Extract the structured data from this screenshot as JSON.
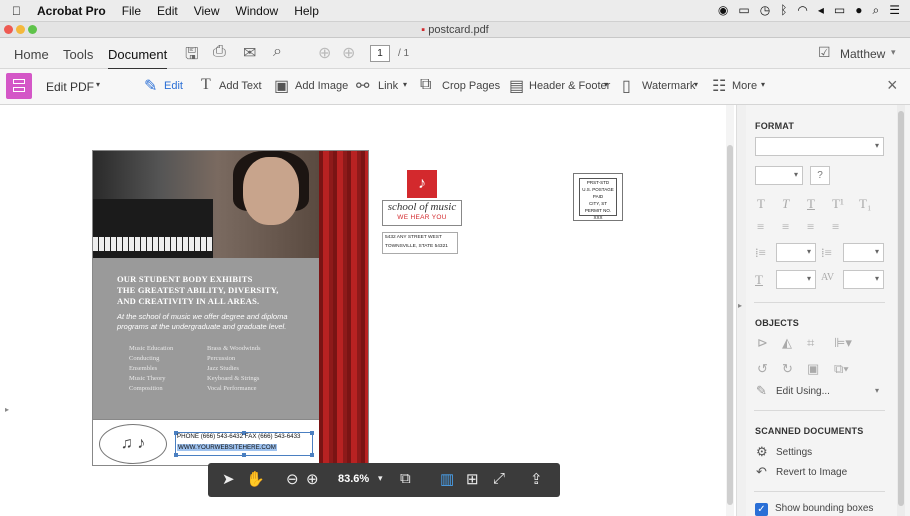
{
  "menubar": {
    "app": "Acrobat Pro",
    "items": [
      "File",
      "Edit",
      "View",
      "Window",
      "Help"
    ]
  },
  "window": {
    "title": "postcard.pdf"
  },
  "topnav": {
    "tabs": [
      "Home",
      "Tools",
      "Document"
    ],
    "page_current": "1",
    "page_total": "/ 1",
    "user": "Matthew"
  },
  "edit_toolbar": {
    "title": "Edit PDF",
    "tools": {
      "edit": "Edit",
      "add_text": "Add Text",
      "add_image": "Add Image",
      "link": "Link",
      "crop": "Crop Pages",
      "header_footer": "Header & Footer",
      "watermark": "Watermark",
      "more": "More"
    }
  },
  "flyer": {
    "headline": [
      "OUR STUDENT BODY EXHIBITS",
      "THE GREATEST ABILITY, DIVERSITY,",
      "AND CREATIVITY IN ALL AREAS."
    ],
    "tagline": [
      "At the school of music we offer degree and diploma",
      "programs at the undergraduate and graduate level."
    ],
    "programs_left": [
      "Music Education",
      "Conducting",
      "Ensembles",
      "Music Theory",
      "Composition"
    ],
    "programs_right": [
      "Brass & Woodwinds",
      "Percussion",
      "Jazz Studies",
      "Keyboard & Strings",
      "Vocal Performance"
    ],
    "phone": "PHONE (666) 543-6432   FAX (666) 543-6433",
    "website": "WWW.YOURWEBSITEHERE.COM"
  },
  "postcard_back": {
    "logo_name": "school of music",
    "logo_tagline": "WE HEAR YOU",
    "address": [
      "5432 ANY STREET WEST",
      "TOWNSVILLE, STATE 54321"
    ],
    "stamp": [
      "PRST-STD",
      "U.S. POSTAGE",
      "PAID",
      "CITY, ST",
      "PERMIT NO. XXX"
    ]
  },
  "float_toolbar": {
    "zoom": "83.6%"
  },
  "right_panel": {
    "format_label": "FORMAT",
    "objects_label": "OBJECTS",
    "edit_using": "Edit Using...",
    "scanned_label": "SCANNED DOCUMENTS",
    "settings": "Settings",
    "revert": "Revert to Image",
    "show_bounding": "Show bounding boxes"
  },
  "colors": {
    "accent_pink": "#d457c7",
    "brand_red": "#d3292d",
    "selection_blue": "#4a7fc1"
  }
}
